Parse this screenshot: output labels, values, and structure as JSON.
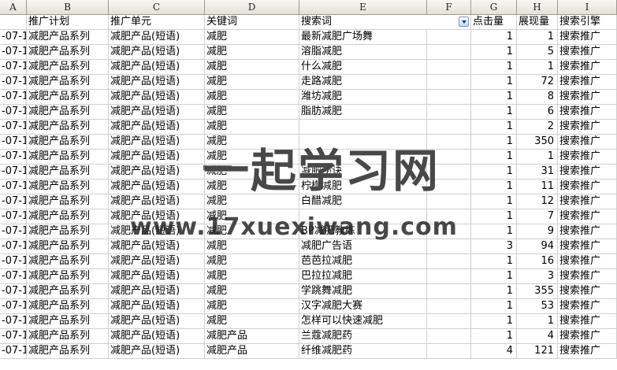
{
  "columns": [
    "A",
    "B",
    "C",
    "D",
    "E",
    "F",
    "G",
    "H",
    "I"
  ],
  "headers": {
    "plan": "推广计划",
    "unit": "推广单元",
    "keyword": "关键词",
    "search_term": "搜索词",
    "clicks": "点击量",
    "impressions": "展现量",
    "engine": "搜索引擎"
  },
  "rows": [
    {
      "date": "-07-1",
      "plan": "减肥产品系列",
      "unit": "减肥产品(短语)",
      "keyword": "减肥",
      "term": "最新减肥广场舞",
      "clicks": "1",
      "impressions": "1",
      "engine": "搜索推广"
    },
    {
      "date": "-07-1",
      "plan": "减肥产品系列",
      "unit": "减肥产品(短语)",
      "keyword": "减肥",
      "term": "溶脂减肥",
      "clicks": "1",
      "impressions": "5",
      "engine": "搜索推广"
    },
    {
      "date": "-07-1",
      "plan": "减肥产品系列",
      "unit": "减肥产品(短语)",
      "keyword": "减肥",
      "term": "什么减肥",
      "clicks": "1",
      "impressions": "1",
      "engine": "搜索推广"
    },
    {
      "date": "-07-1",
      "plan": "减肥产品系列",
      "unit": "减肥产品(短语)",
      "keyword": "减肥",
      "term": "走路减肥",
      "clicks": "1",
      "impressions": "72",
      "engine": "搜索推广"
    },
    {
      "date": "-07-1",
      "plan": "减肥产品系列",
      "unit": "减肥产品(短语)",
      "keyword": "减肥",
      "term": "潍坊减肥",
      "clicks": "1",
      "impressions": "8",
      "engine": "搜索推广"
    },
    {
      "date": "-07-1",
      "plan": "减肥产品系列",
      "unit": "减肥产品(短语)",
      "keyword": "减肥",
      "term": "脂肪减肥",
      "clicks": "1",
      "impressions": "6",
      "engine": "搜索推广"
    },
    {
      "date": "-07-1",
      "plan": "减肥产品系列",
      "unit": "减肥产品(短语)",
      "keyword": "减肥",
      "term": "",
      "clicks": "1",
      "impressions": "2",
      "engine": "搜索推广"
    },
    {
      "date": "-07-1",
      "plan": "减肥产品系列",
      "unit": "减肥产品(短语)",
      "keyword": "减肥",
      "term": "",
      "clicks": "1",
      "impressions": "350",
      "engine": "搜索推广"
    },
    {
      "date": "-07-1",
      "plan": "减肥产品系列",
      "unit": "减肥产品(短语)",
      "keyword": "减肥",
      "term": "",
      "clicks": "1",
      "impressions": "1",
      "engine": "搜索推广"
    },
    {
      "date": "-07-1",
      "plan": "减肥产品系列",
      "unit": "减肥产品(短语)",
      "keyword": "减肥",
      "term": "减肥秘诀",
      "clicks": "1",
      "impressions": "31",
      "engine": "搜索推广"
    },
    {
      "date": "-07-1",
      "plan": "减肥产品系列",
      "unit": "减肥产品(短语)",
      "keyword": "减肥",
      "term": "柠檬减肥",
      "clicks": "1",
      "impressions": "11",
      "engine": "搜索推广"
    },
    {
      "date": "-07-1",
      "plan": "减肥产品系列",
      "unit": "减肥产品(短语)",
      "keyword": "减肥",
      "term": "白醋减肥",
      "clicks": "1",
      "impressions": "12",
      "engine": "搜索推广"
    },
    {
      "date": "-07-1",
      "plan": "减肥产品系列",
      "unit": "减肥产品(短语)",
      "keyword": "减肥",
      "term": "",
      "clicks": "1",
      "impressions": "7",
      "engine": "搜索推广"
    },
    {
      "date": "-07-1",
      "plan": "减肥产品系列",
      "unit": "减肥产品(短语)",
      "keyword": "减肥",
      "term": "BP减肥教练",
      "clicks": "1",
      "impressions": "9",
      "engine": "搜索推广"
    },
    {
      "date": "-07-1",
      "plan": "减肥产品系列",
      "unit": "减肥产品(短语)",
      "keyword": "减肥",
      "term": "减肥广告语",
      "clicks": "3",
      "impressions": "94",
      "engine": "搜索推广"
    },
    {
      "date": "-07-1",
      "plan": "减肥产品系列",
      "unit": "减肥产品(短语)",
      "keyword": "减肥",
      "term": "芭芭拉减肥",
      "clicks": "1",
      "impressions": "16",
      "engine": "搜索推广"
    },
    {
      "date": "-07-1",
      "plan": "减肥产品系列",
      "unit": "减肥产品(短语)",
      "keyword": "减肥",
      "term": "巴拉拉减肥",
      "clicks": "1",
      "impressions": "3",
      "engine": "搜索推广"
    },
    {
      "date": "-07-1",
      "plan": "减肥产品系列",
      "unit": "减肥产品(短语)",
      "keyword": "减肥",
      "term": "学跳舞减肥",
      "clicks": "1",
      "impressions": "355",
      "engine": "搜索推广"
    },
    {
      "date": "-07-1",
      "plan": "减肥产品系列",
      "unit": "减肥产品(短语)",
      "keyword": "减肥",
      "term": "汉字减肥大赛",
      "clicks": "1",
      "impressions": "53",
      "engine": "搜索推广"
    },
    {
      "date": "-07-1",
      "plan": "减肥产品系列",
      "unit": "减肥产品(短语)",
      "keyword": "减肥",
      "term": "怎样可以快速减肥",
      "clicks": "1",
      "impressions": "1",
      "engine": "搜索推广"
    },
    {
      "date": "-07-1",
      "plan": "减肥产品系列",
      "unit": "减肥产品(短语)",
      "keyword": "减肥产品",
      "term": "兰蔻减肥药",
      "clicks": "1",
      "impressions": "4",
      "engine": "搜索推广"
    },
    {
      "date": "-07-1",
      "plan": "减肥产品系列",
      "unit": "减肥产品(短语)",
      "keyword": "减肥产品",
      "term": "纤维减肥药",
      "clicks": "4",
      "impressions": "121",
      "engine": "搜索推广"
    }
  ],
  "watermark": {
    "title": "一起学习网",
    "url": "www.17xuexiwang.com"
  }
}
